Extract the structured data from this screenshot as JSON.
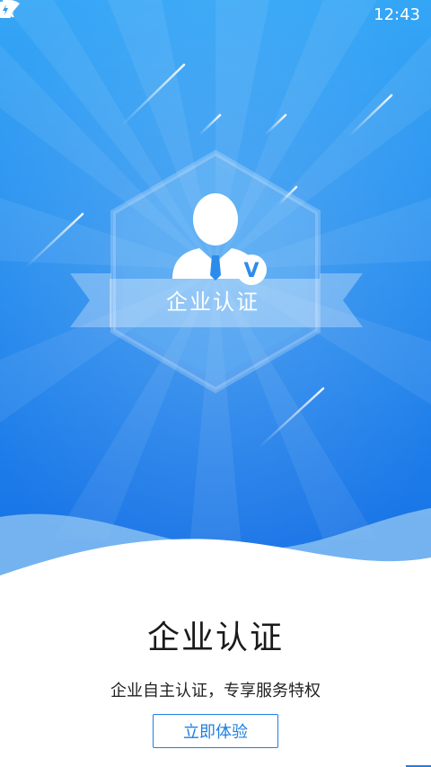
{
  "status_bar": {
    "time": "12:43",
    "icons": [
      "wifi-icon",
      "no-sim-icon",
      "battery-charging-icon"
    ]
  },
  "hero": {
    "badge_label": "企业认证",
    "verified_mark": "V"
  },
  "content": {
    "title": "企业认证",
    "subtitle": "企业自主认证，专享服务特权",
    "cta_label": "立即体验"
  },
  "colors": {
    "hero_top": "#2b9cf3",
    "hero_bottom": "#1673e6",
    "accent": "#1f7fe0"
  }
}
